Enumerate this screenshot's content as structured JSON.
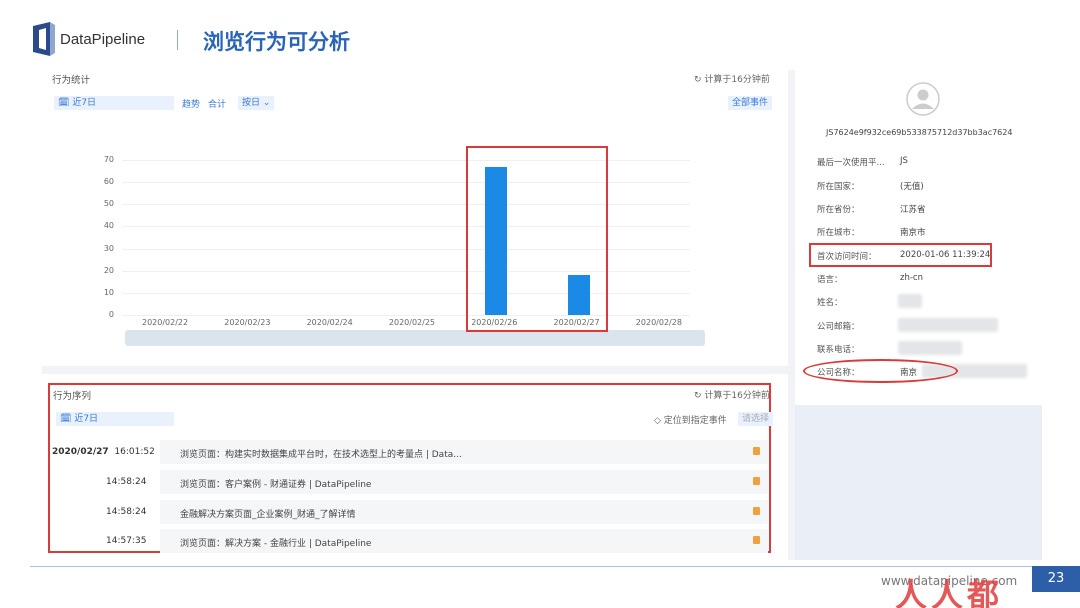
{
  "header": {
    "brand": "DataPipeline",
    "title": "浏览行为可分析"
  },
  "stats": {
    "title": "行为统计",
    "computed": "计算于16分钟前",
    "date_range": "近7日",
    "trend": "趋势",
    "total": "合计",
    "by_day": "按日",
    "all_events": "全部事件"
  },
  "chart_data": {
    "type": "bar",
    "categories": [
      "2020/02/22",
      "2020/02/23",
      "2020/02/24",
      "2020/02/25",
      "2020/02/26",
      "2020/02/27",
      "2020/02/28"
    ],
    "values": [
      0,
      0,
      0,
      0,
      67,
      18,
      0
    ],
    "ylim": [
      0,
      70
    ],
    "yticks": [
      "70",
      "60",
      "50",
      "40",
      "30",
      "20",
      "10",
      "0"
    ],
    "grid": true,
    "colors": {
      "bar": "#1b8ae6",
      "highlight": "#d93a3a"
    }
  },
  "sequence": {
    "title": "行为序列",
    "computed": "计算于16分钟前",
    "date_range": "近7日",
    "locate": "定位到指定事件",
    "select_placeholder": "请选择",
    "rows": [
      {
        "date": "2020/02/27",
        "time": "16:01:52",
        "text": "浏览页面：构建实时数据集成平台时，在技术选型上的考量点 | Data..."
      },
      {
        "date": "",
        "time": "14:58:24",
        "text": "浏览页面：客户案例 - 财通证券 | DataPipeline"
      },
      {
        "date": "",
        "time": "14:58:24",
        "text": "金融解决方案页面_企业案例_财通_了解详情"
      },
      {
        "date": "",
        "time": "14:57:35",
        "text": "浏览页面：解决方案 - 金融行业 | DataPipeline"
      }
    ]
  },
  "profile": {
    "id": "JS7624e9f932ce69b533875712d37bb3ac7624",
    "fields": [
      {
        "k": "最后一次使用平...",
        "v": "JS"
      },
      {
        "k": "所在国家：",
        "v": "(无值)"
      },
      {
        "k": "所在省份：",
        "v": "江苏省"
      },
      {
        "k": "所在城市：",
        "v": "南京市"
      },
      {
        "k": "首次访问时间：",
        "v": "2020-01-06 11:39:24"
      },
      {
        "k": "语言：",
        "v": "zh-cn"
      },
      {
        "k": "姓名：",
        "v": ""
      },
      {
        "k": "公司邮箱：",
        "v": ""
      },
      {
        "k": "联系电话：",
        "v": ""
      },
      {
        "k": "公司名称：",
        "v": "南京"
      }
    ]
  },
  "footer": {
    "url": "www.datapipeline.com",
    "page": "23",
    "watermark": "人人都"
  }
}
